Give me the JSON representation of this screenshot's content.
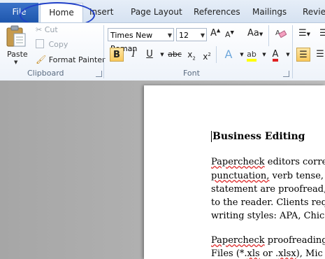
{
  "tabs": {
    "file": "File",
    "home": "Home",
    "insert": "Insert",
    "page_layout": "Page Layout",
    "references": "References",
    "mailings": "Mailings",
    "review": "Review"
  },
  "clipboard": {
    "paste": "Paste",
    "cut": "Cut",
    "copy": "Copy",
    "format_painter": "Format Painter",
    "group_label": "Clipboard"
  },
  "font": {
    "family": "Times New Roman",
    "size": "12",
    "group_label": "Font"
  },
  "document": {
    "title": "Business Editing",
    "p1_l1_a": "Papercheck",
    "p1_l1_b": " editors correc",
    "p1_l2_a": "punctuation,",
    "p1_l2_b": " verb tense, s",
    "p1_l3": "statement are proofread, e",
    "p1_l4": "to the reader. Clients requ",
    "p1_l5": "writing styles: APA, Chic",
    "p2_l1_a": "Papercheck",
    "p2_l1_b": " proofreading",
    "p2_l2_a": "Files (*.",
    "p2_l2_b": "xls",
    "p2_l2_c": " or .",
    "p2_l2_d": "xlsx",
    "p2_l2_e": "),  Mic"
  },
  "colors": {
    "file_tab": "#2a62b8",
    "annotation_ellipse": "#1f3fc8",
    "highlight": "#ffff00",
    "font_color": "#e02020"
  }
}
